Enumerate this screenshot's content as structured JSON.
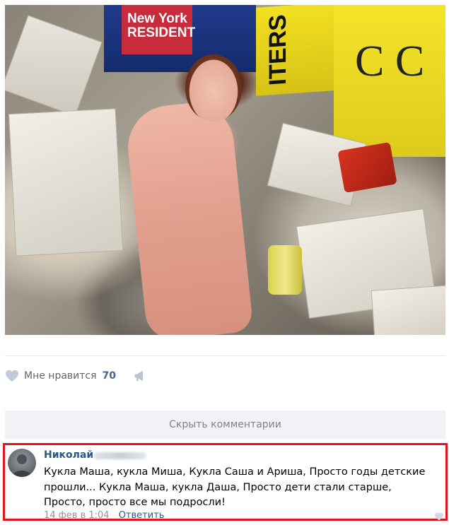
{
  "photo": {
    "sign_text": "New York RESIDENT",
    "box_text": "ITERS",
    "paper_logo": "C C"
  },
  "likes": {
    "label": "Мне нравится",
    "count": "70",
    "heart_icon": "heart-icon",
    "share_icon": "megaphone-icon"
  },
  "comments_toggle": {
    "label": "Скрыть комментарии"
  },
  "comment": {
    "author": "Николай",
    "text": "Кукла Маша, кукла Миша, Кукла Саша и Ариша, Просто годы детские прошли... Кукла Маша, кукла Даша, Просто дети стали старше, Просто, просто все мы подросли!",
    "date": "14 фев в 1:04",
    "reply_label": "Ответить"
  },
  "colors": {
    "link": "#2a5885",
    "like_count": "#42648b",
    "highlight_border": "#e0161c",
    "button_bg": "#f0f2f5"
  }
}
